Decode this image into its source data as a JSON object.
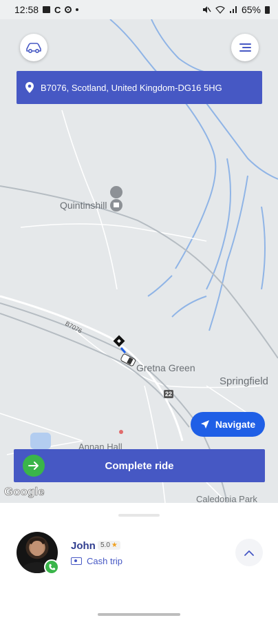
{
  "status_bar": {
    "time": "12:58",
    "carrier_letter": "C",
    "battery_percent": "65%"
  },
  "map": {
    "places": {
      "quintinshill": "Quintinshill",
      "gretna_green": "Gretna Green",
      "springfield": "Springfield",
      "annan_hall": "Annan Hall",
      "caledonia_park": "Caledonia Park"
    },
    "road_label": "B7076",
    "motorway_shield": "22",
    "attribution": "Google"
  },
  "header": {
    "address": "B7076, Scotland, United Kingdom-DG16 5HG"
  },
  "buttons": {
    "navigate": "Navigate",
    "complete_ride": "Complete ride"
  },
  "driver": {
    "name": "John",
    "rating": "5.0",
    "trip_type": "Cash trip"
  },
  "colors": {
    "primary": "#4658c4",
    "navigate": "#1f5fe6",
    "success": "#3ab54a",
    "map_bg": "#e5e8ea",
    "water": "#8fb4e6"
  }
}
